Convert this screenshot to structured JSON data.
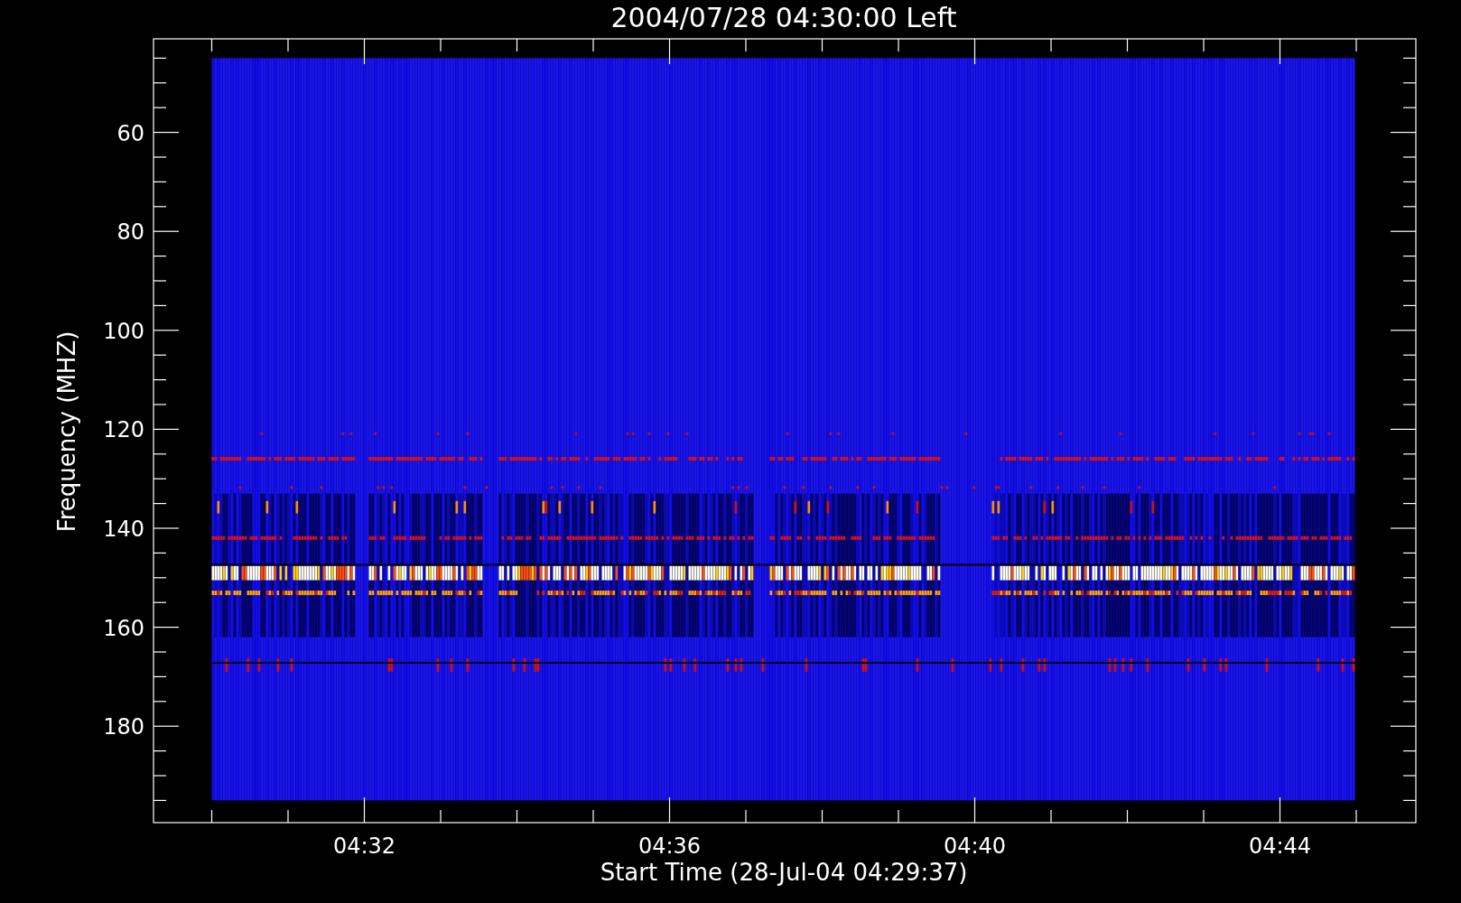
{
  "plot": {
    "title": "2004/07/28 04:30:00 Left",
    "y_axis": {
      "title": "Frequency (MHZ)",
      "ticks": [
        "60",
        "80",
        "100",
        "120",
        "140",
        "160",
        "180"
      ]
    },
    "x_axis": {
      "title": "Start Time (28-Jul-04 04:29:37)",
      "ticks": [
        "04:32",
        "04:36",
        "04:40",
        "04:44"
      ]
    }
  }
}
